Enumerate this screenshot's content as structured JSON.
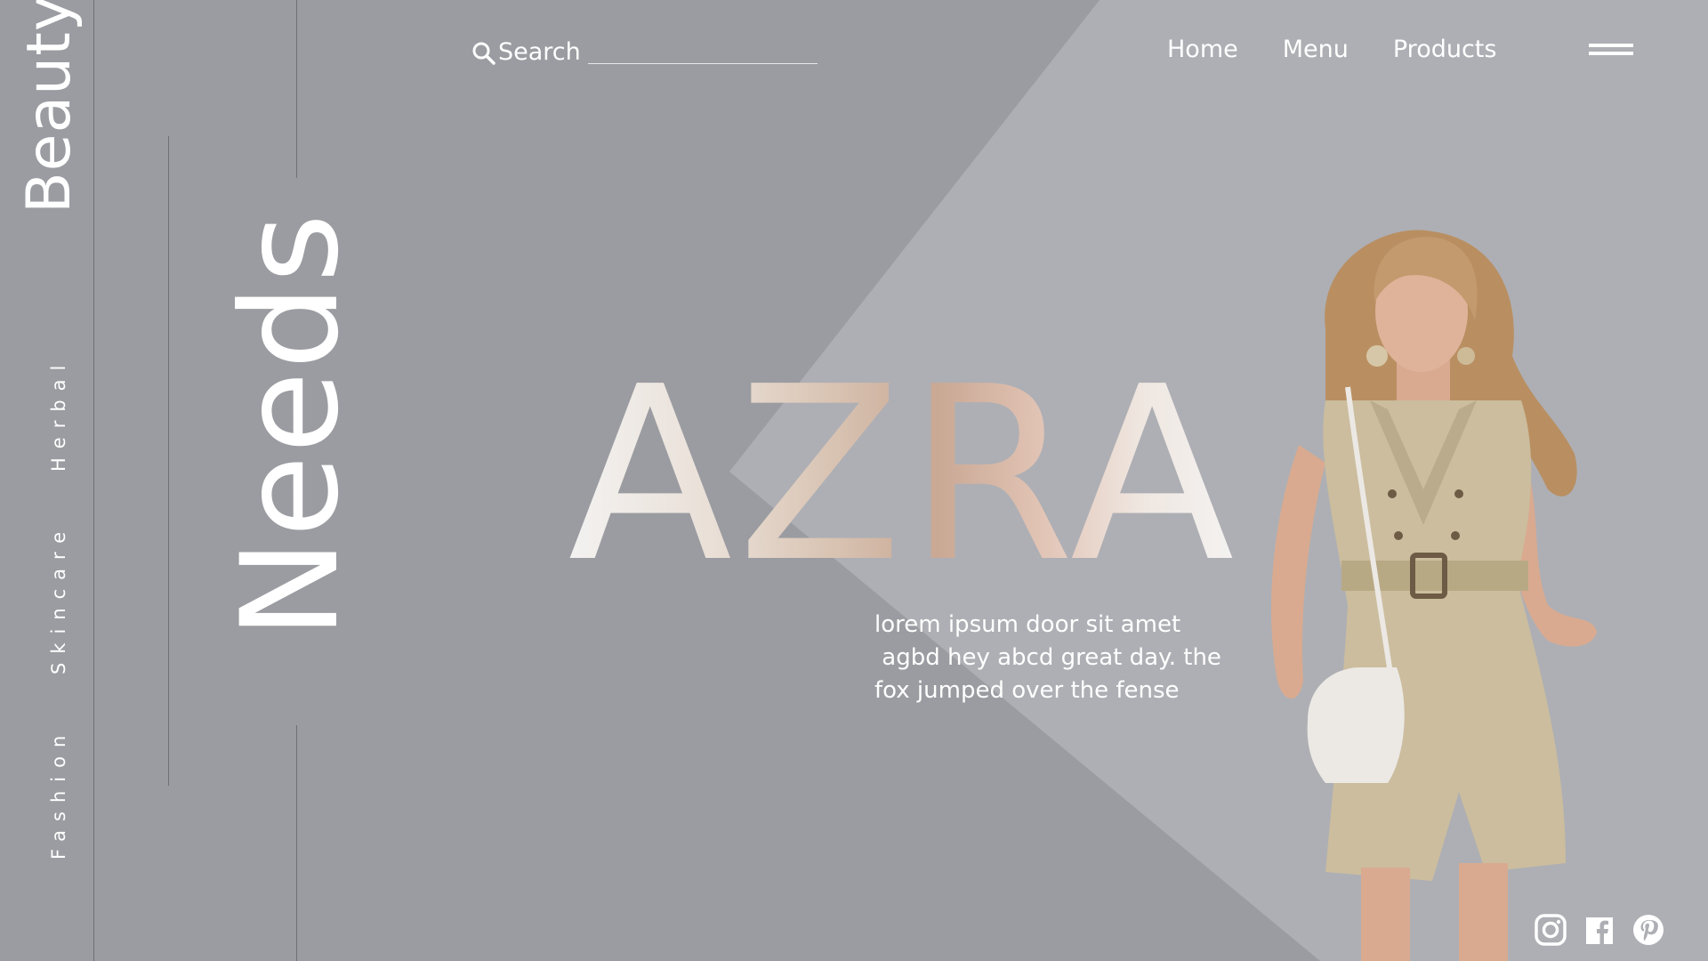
{
  "brand": {
    "vertical_text": "Beauty"
  },
  "categories": [
    {
      "label": "Herbal"
    },
    {
      "label": "Skincare"
    },
    {
      "label": "Fashion"
    }
  ],
  "hero": {
    "needs_text": "Needs",
    "title": "AZRA",
    "tagline": "lorem ipsum door sit amet\n agbd hey abcd great day. the\nfox jumped over the fense"
  },
  "search": {
    "label": "Search",
    "value": ""
  },
  "nav": {
    "items": [
      {
        "label": "Home"
      },
      {
        "label": "Menu"
      },
      {
        "label": "Products"
      }
    ]
  },
  "icons": {
    "search": "search-icon",
    "menu": "hamburger-menu-icon",
    "social": [
      "instagram-icon",
      "facebook-icon",
      "pinterest-icon"
    ]
  },
  "colors": {
    "background": "#9b9ca1",
    "light_panel": "#aeafb4",
    "text": "#ffffff",
    "outfit": "#cbbd9e",
    "hair": "#b98f62",
    "skin": "#d9aa90"
  }
}
